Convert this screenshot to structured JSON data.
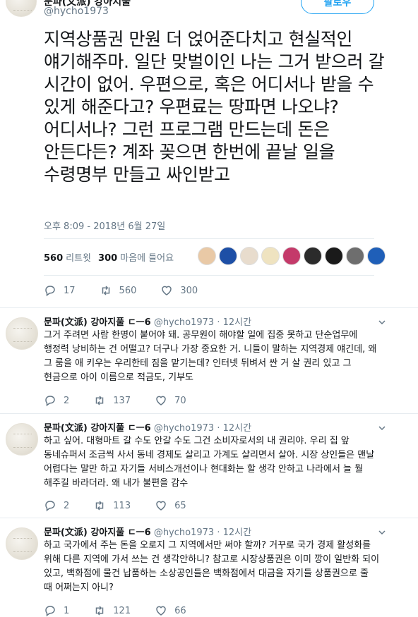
{
  "tweet": {
    "author_name": "문파(文派) 강아지풀",
    "handle": "@hycho1973",
    "follow_label": "팔로우",
    "text": "지역상품권 만원 더 얹어준다치고 현실적인 얘기해주마. 일단 맞벌이인 나는 그거 받으러 갈 시간이 없어. 우편으로, 혹은 어디서나 받을 수 있게 해준다고? 우편료는 땅파면 나오냐? 어디서나? 그런 프로그램 만드는데 돈은 안든다든? 계좌 꽂으면 한번에 끝날 일을 수령명부 만들고 싸인받고",
    "timestamp": "오후 8:09 - 2018년 6월 27일",
    "retweets_count": "560",
    "retweets_label": "리트윗",
    "likes_count": "300",
    "likes_label": "마음에 들어요",
    "actions": {
      "replies": "17",
      "retweets": "560",
      "likes": "300"
    },
    "liker_colors": [
      "#e9c9a6",
      "#1d4fa6",
      "#e8dccd",
      "#efe3c0",
      "#c43a6a",
      "#2b2b2b",
      "#1a1a1a",
      "#6e6e6e",
      "#1f5fb8"
    ]
  },
  "replies": [
    {
      "name": "문파(文派) 강아지풀 ㄷㅡ6",
      "handle": "@hycho1973",
      "time": "· 12시간",
      "text": "그거 주려면 사람 한명이 붙어야 돼. 공무원이 해야할 일에 집중 못하고 단순업무에 행정력 낭비하는 건 어떨고? 더구나 가장 중요한 거. 니들이 말하는 지역경제 얘긴데, 왜 그 룸을 애 키우는 우리한테 짐을 맡기는데? 인터넷 뒤벼서 싼 거 살 권리 있고 그 현금으로 아이 이름으로 적금도, 기부도",
      "replies": "2",
      "retweets": "137",
      "likes": "70"
    },
    {
      "name": "문파(文派) 강아지풀 ㄷㅡ6",
      "handle": "@hycho1973",
      "time": "· 12시간",
      "text": "하고 싶어. 대형마트 갈 수도 안갈 수도 그건 소비자로서의 내 권리야. 우리 집 앞 동네슈퍼서 조금씩 사서 동네 경제도 살리고 가계도 살리면서 살아. 시장 상인들은 맨날 어렵다는 말만 하고 자기들 서비스개선이나 현대화는 할 생각 안하고 나라에서 늘 뭘 해주길 바라더라. 왜 내가 불편을 감수",
      "replies": "2",
      "retweets": "113",
      "likes": "65"
    },
    {
      "name": "문파(文派) 강아지풀 ㄷㅡ6",
      "handle": "@hycho1973",
      "time": "· 12시간",
      "text": "하고 국가에서 주는 돈을 오로지 그 지역에서만 써야 할까? 거꾸로 국가 경제 활성화를 위해 다른 지역에 가서 쓰는 건 생각안하니? 참고로 시장상품권은 이미 깡이 일반화 되이 있고, 백화점에 물건 납품하는 소상공인들은 백화점에서 대금을 자기들 상품권으로 줄 때 어쩌는지 아니?",
      "replies": "1",
      "retweets": "121",
      "likes": "66"
    }
  ]
}
